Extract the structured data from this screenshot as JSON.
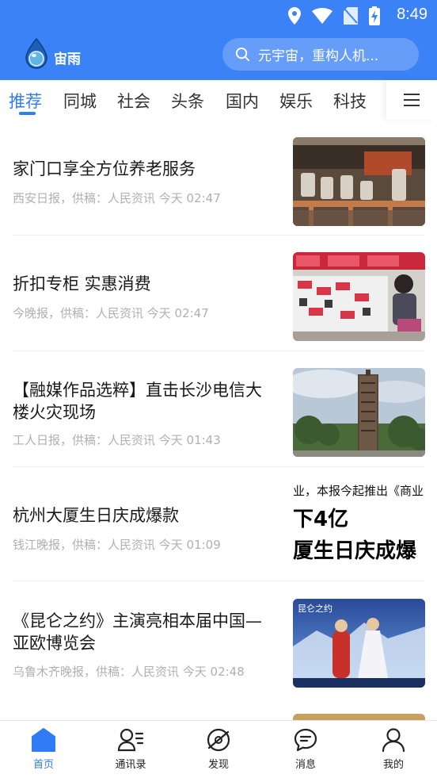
{
  "status": {
    "time": "8:49"
  },
  "header": {
    "logo_text": "宙雨",
    "search_placeholder": "元宇宙，重构人机..."
  },
  "colors": {
    "brand": "#3b82f6",
    "active": "#2f7cf6"
  },
  "tabs": [
    {
      "label": "推荐",
      "active": true
    },
    {
      "label": "同城"
    },
    {
      "label": "社会"
    },
    {
      "label": "头条"
    },
    {
      "label": "国内"
    },
    {
      "label": "娱乐"
    },
    {
      "label": "科技"
    }
  ],
  "news": [
    {
      "title": "家门口享全方位养老服务",
      "meta": "西安日报，供稿：人民资讯 今天 02:47",
      "thumb": "elderly-dining-hall-photo"
    },
    {
      "title": "折扣专柜 实惠消费",
      "meta": "今晚报，供稿：人民资讯 今天 02:47",
      "thumb": "discount-store-shopper-photo"
    },
    {
      "title": "【融媒作品选粹】直击长沙电信大楼火灾现场",
      "meta": "工人日报，供稿：人民资讯 今天 01:43",
      "thumb": "burned-telecom-tower-photo"
    },
    {
      "title": "杭州大厦生日庆成爆款",
      "meta": "钱江晚报，供稿：人民资讯 今天 01:09",
      "thumb": "newspaper-headline-photo",
      "thumb_line1": "业，本报今起推出《商业",
      "thumb_line2": "下4亿",
      "thumb_line3": "厦生日庆成爆"
    },
    {
      "title": "《昆仑之约》主演亮相本届中国—亚欧博览会",
      "meta": "乌鲁木齐晚报，供稿：人民资讯 今天 02:48",
      "thumb": "stage-performers-photo",
      "thumb_line1": "昆仑之约"
    }
  ],
  "bottom_nav": [
    {
      "label": "首页",
      "icon": "home-icon",
      "active": true
    },
    {
      "label": "通讯录",
      "icon": "contacts-icon"
    },
    {
      "label": "发现",
      "icon": "discover-icon"
    },
    {
      "label": "消息",
      "icon": "message-icon"
    },
    {
      "label": "我的",
      "icon": "profile-icon"
    }
  ]
}
